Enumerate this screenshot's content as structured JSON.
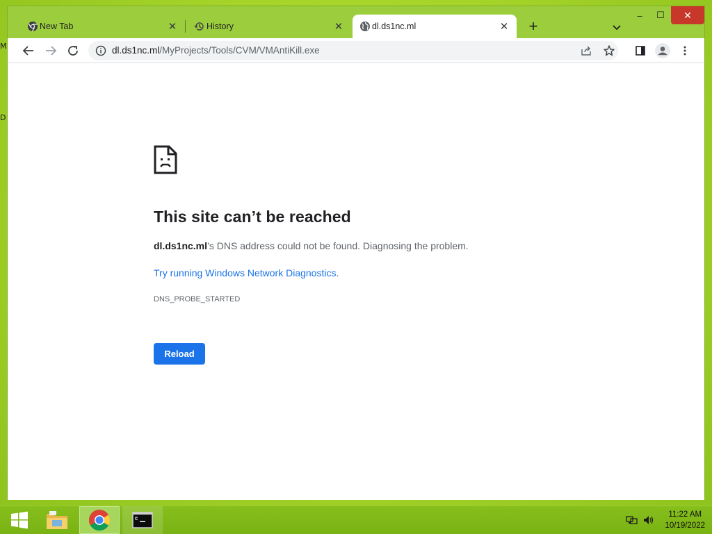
{
  "desktop": {
    "edge_labels": [
      "M",
      "D"
    ]
  },
  "browser": {
    "tabs": [
      {
        "title": "New Tab",
        "icon": "chrome-icon",
        "active": false
      },
      {
        "title": "History",
        "icon": "history-icon",
        "active": false
      },
      {
        "title": "dl.ds1nc.ml",
        "icon": "globe-icon",
        "active": true
      }
    ],
    "new_tab_symbol": "+",
    "window_controls": {
      "minimize": "–",
      "maximize": "☐",
      "close": "✕"
    },
    "address": {
      "host": "dl.ds1nc.ml",
      "path": "/MyProjects/Tools/CVM/VMAntiKill.exe"
    }
  },
  "error_page": {
    "title": "This site can’t be reached",
    "host_bold": "dl.ds1nc.ml",
    "description_rest": "’s DNS address could not be found. Diagnosing the problem.",
    "link_text": "Try running Windows Network Diagnostics",
    "link_suffix": ".",
    "error_code": "DNS_PROBE_STARTED",
    "reload_label": "Reload"
  },
  "taskbar": {
    "apps": [
      "start-icon",
      "file-explorer-icon",
      "chrome-icon",
      "command-prompt-icon"
    ],
    "clock_time": "11:22 AM",
    "clock_date": "10/19/2022"
  },
  "colors": {
    "accent": "#1a73e8",
    "desktop_green": "#a9d62a",
    "close_red": "#c7372a"
  }
}
